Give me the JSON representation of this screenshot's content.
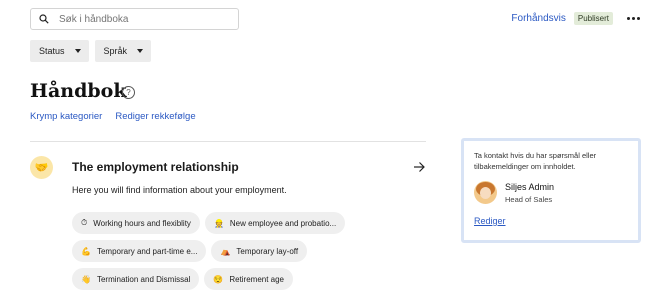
{
  "search": {
    "placeholder": "Søk i håndboka"
  },
  "header": {
    "preview_label": "Forhåndsvis",
    "status_badge": "Publisert"
  },
  "filters": [
    {
      "label": "Status"
    },
    {
      "label": "Språk"
    }
  ],
  "page": {
    "title": "Håndbok",
    "help_icon": "?",
    "actions": [
      {
        "label": "Krymp kategorier"
      },
      {
        "label": "Rediger rekkefølge"
      }
    ]
  },
  "category": {
    "icon": "handshake-icon",
    "title": "The employment relationship",
    "description": "Here you will find information about your employment.",
    "chips": [
      {
        "icon": "⏱",
        "label": "Working hours and flexiblity"
      },
      {
        "icon": "👷",
        "label": "New employee and probatio..."
      },
      {
        "icon": "💪",
        "label": "Temporary and part-time e..."
      },
      {
        "icon": "⛺",
        "label": "Temporary lay-off"
      },
      {
        "icon": "👋",
        "label": "Termination and Dismissal"
      },
      {
        "icon": "😌",
        "label": "Retirement age"
      }
    ]
  },
  "contact": {
    "text": "Ta kontakt hvis du har spørsmål eller tilbakemeldinger om innholdet.",
    "name": "Siljes Admin",
    "role": "Head of Sales",
    "edit_label": "Rediger"
  }
}
